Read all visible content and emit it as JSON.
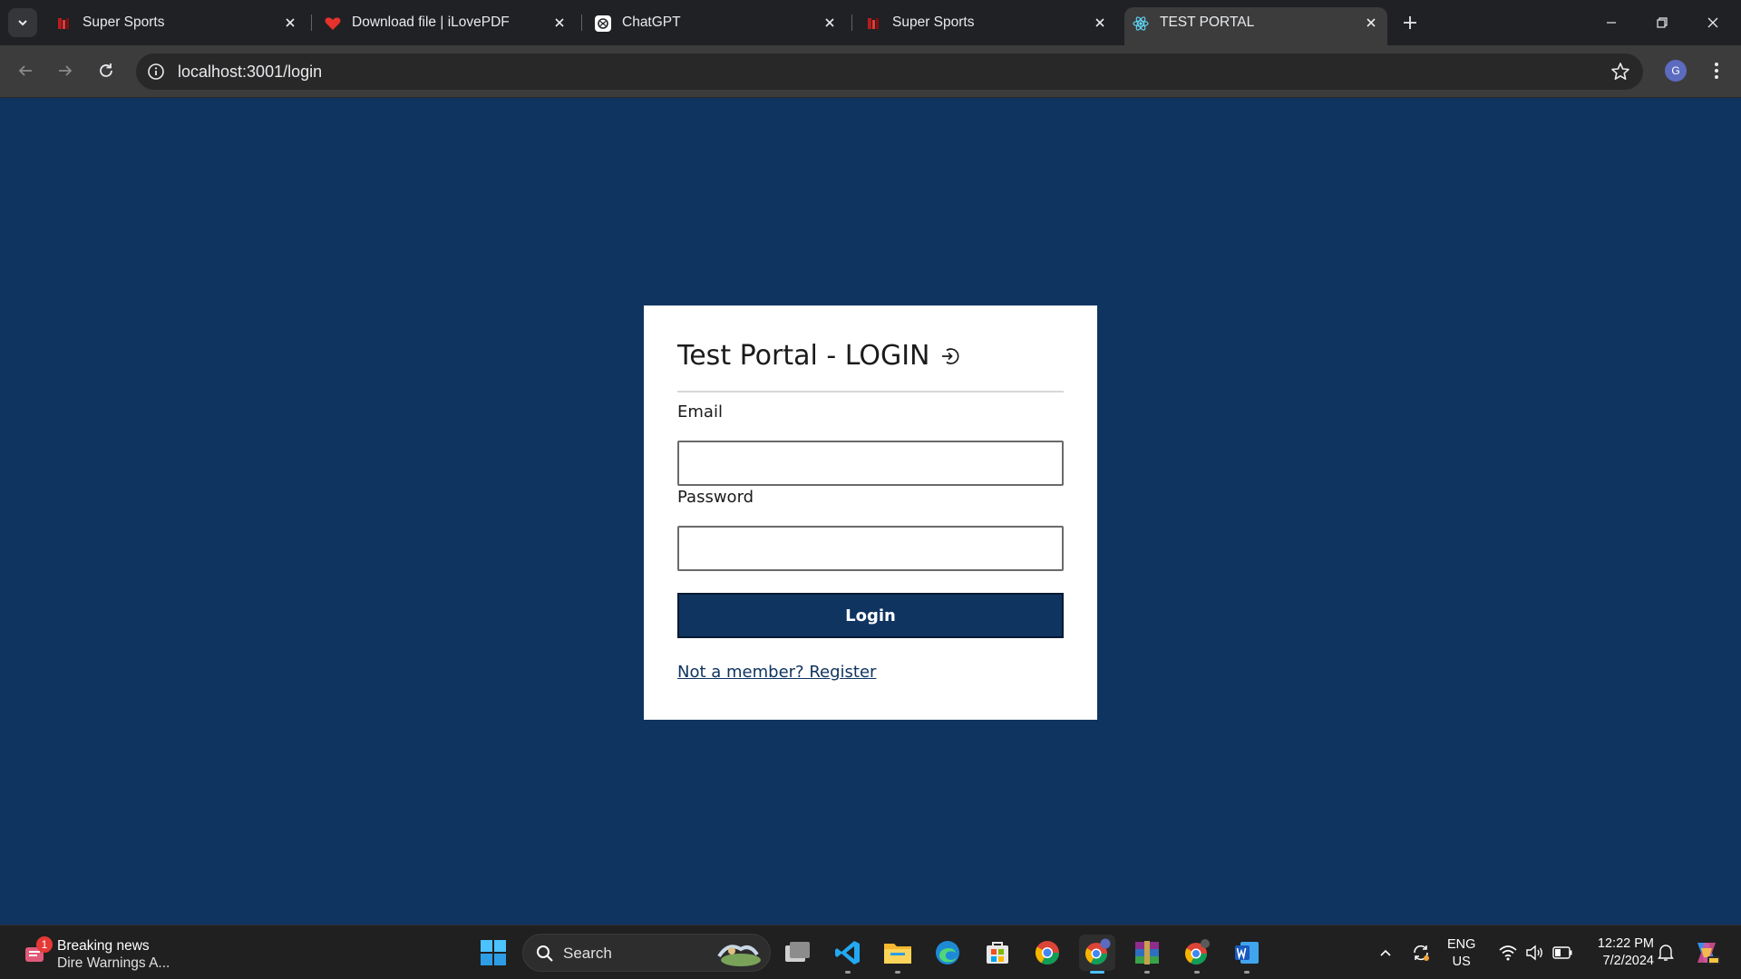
{
  "browser": {
    "tabs": [
      {
        "title": "Super Sports",
        "favicon": "super-sports-favicon",
        "active": false
      },
      {
        "title": "Download file | iLovePDF",
        "favicon": "ilovepdf-heart-favicon",
        "active": false
      },
      {
        "title": "ChatGPT",
        "favicon": "chatgpt-favicon",
        "active": false
      },
      {
        "title": "Super Sports",
        "favicon": "super-sports-favicon",
        "active": false
      },
      {
        "title": "TEST PORTAL",
        "favicon": "react-favicon",
        "active": true
      }
    ],
    "url": "localhost:3001/login",
    "profile_initial": "G"
  },
  "login": {
    "title": "Test Portal - LOGIN",
    "email_label": "Email",
    "email_value": "",
    "password_label": "Password",
    "password_value": "",
    "submit_label": "Login",
    "register_link": "Not a member? Register"
  },
  "taskbar": {
    "news_badge": "1",
    "news_title": "Breaking news",
    "news_subtitle": "Dire Warnings A...",
    "search_label": "Search",
    "language_line1": "ENG",
    "language_line2": "US",
    "time": "12:22 PM",
    "date": "7/2/2024"
  },
  "colors": {
    "page_background": "#0f3460",
    "button_background": "#0f3460",
    "tabstrip": "#202124",
    "toolbar": "#3c3c3c"
  }
}
